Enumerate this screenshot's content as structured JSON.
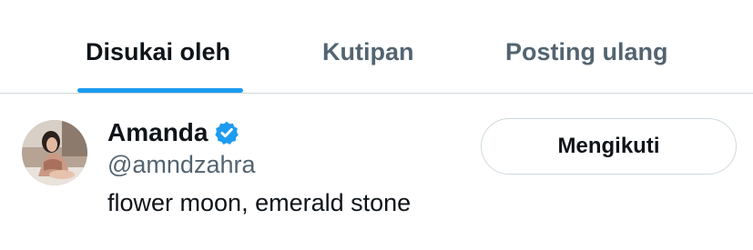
{
  "tabs": [
    {
      "label": "Disukai oleh",
      "active": true
    },
    {
      "label": "Kutipan",
      "active": false
    },
    {
      "label": "Posting ulang",
      "active": false
    }
  ],
  "colors": {
    "accent": "#1d9bf0",
    "primary_text": "#0f1419",
    "secondary_text": "#536471",
    "divider": "#cfd9de"
  },
  "user": {
    "name": "Amanda",
    "verified_icon": "verified-badge-icon",
    "handle": "@amndzahra",
    "bio": "flower moon, emerald stone",
    "follow_label": "Mengikuti"
  }
}
